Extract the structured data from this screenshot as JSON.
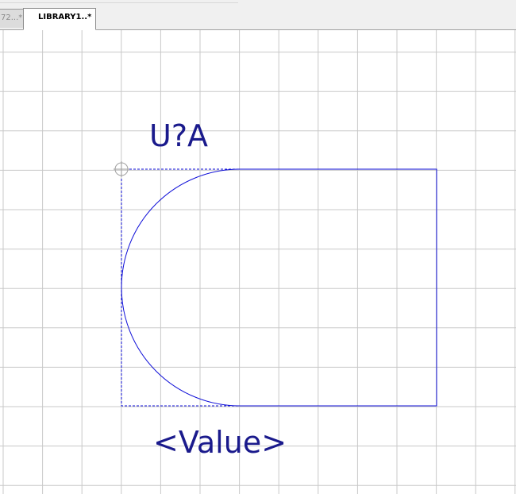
{
  "tabs": [
    {
      "label": "72...*",
      "active": false
    },
    {
      "label": "LIBRARY1..*",
      "active": true
    }
  ],
  "part": {
    "reference": "U?A",
    "value": "<Value>"
  },
  "colors": {
    "grid": "#c8c8c8",
    "body_outline": "#1010d8",
    "label_text": "#1a1a8c",
    "origin_marker": "#a0a0a0"
  },
  "icons": {
    "origin": "crosshair-circle-icon"
  }
}
